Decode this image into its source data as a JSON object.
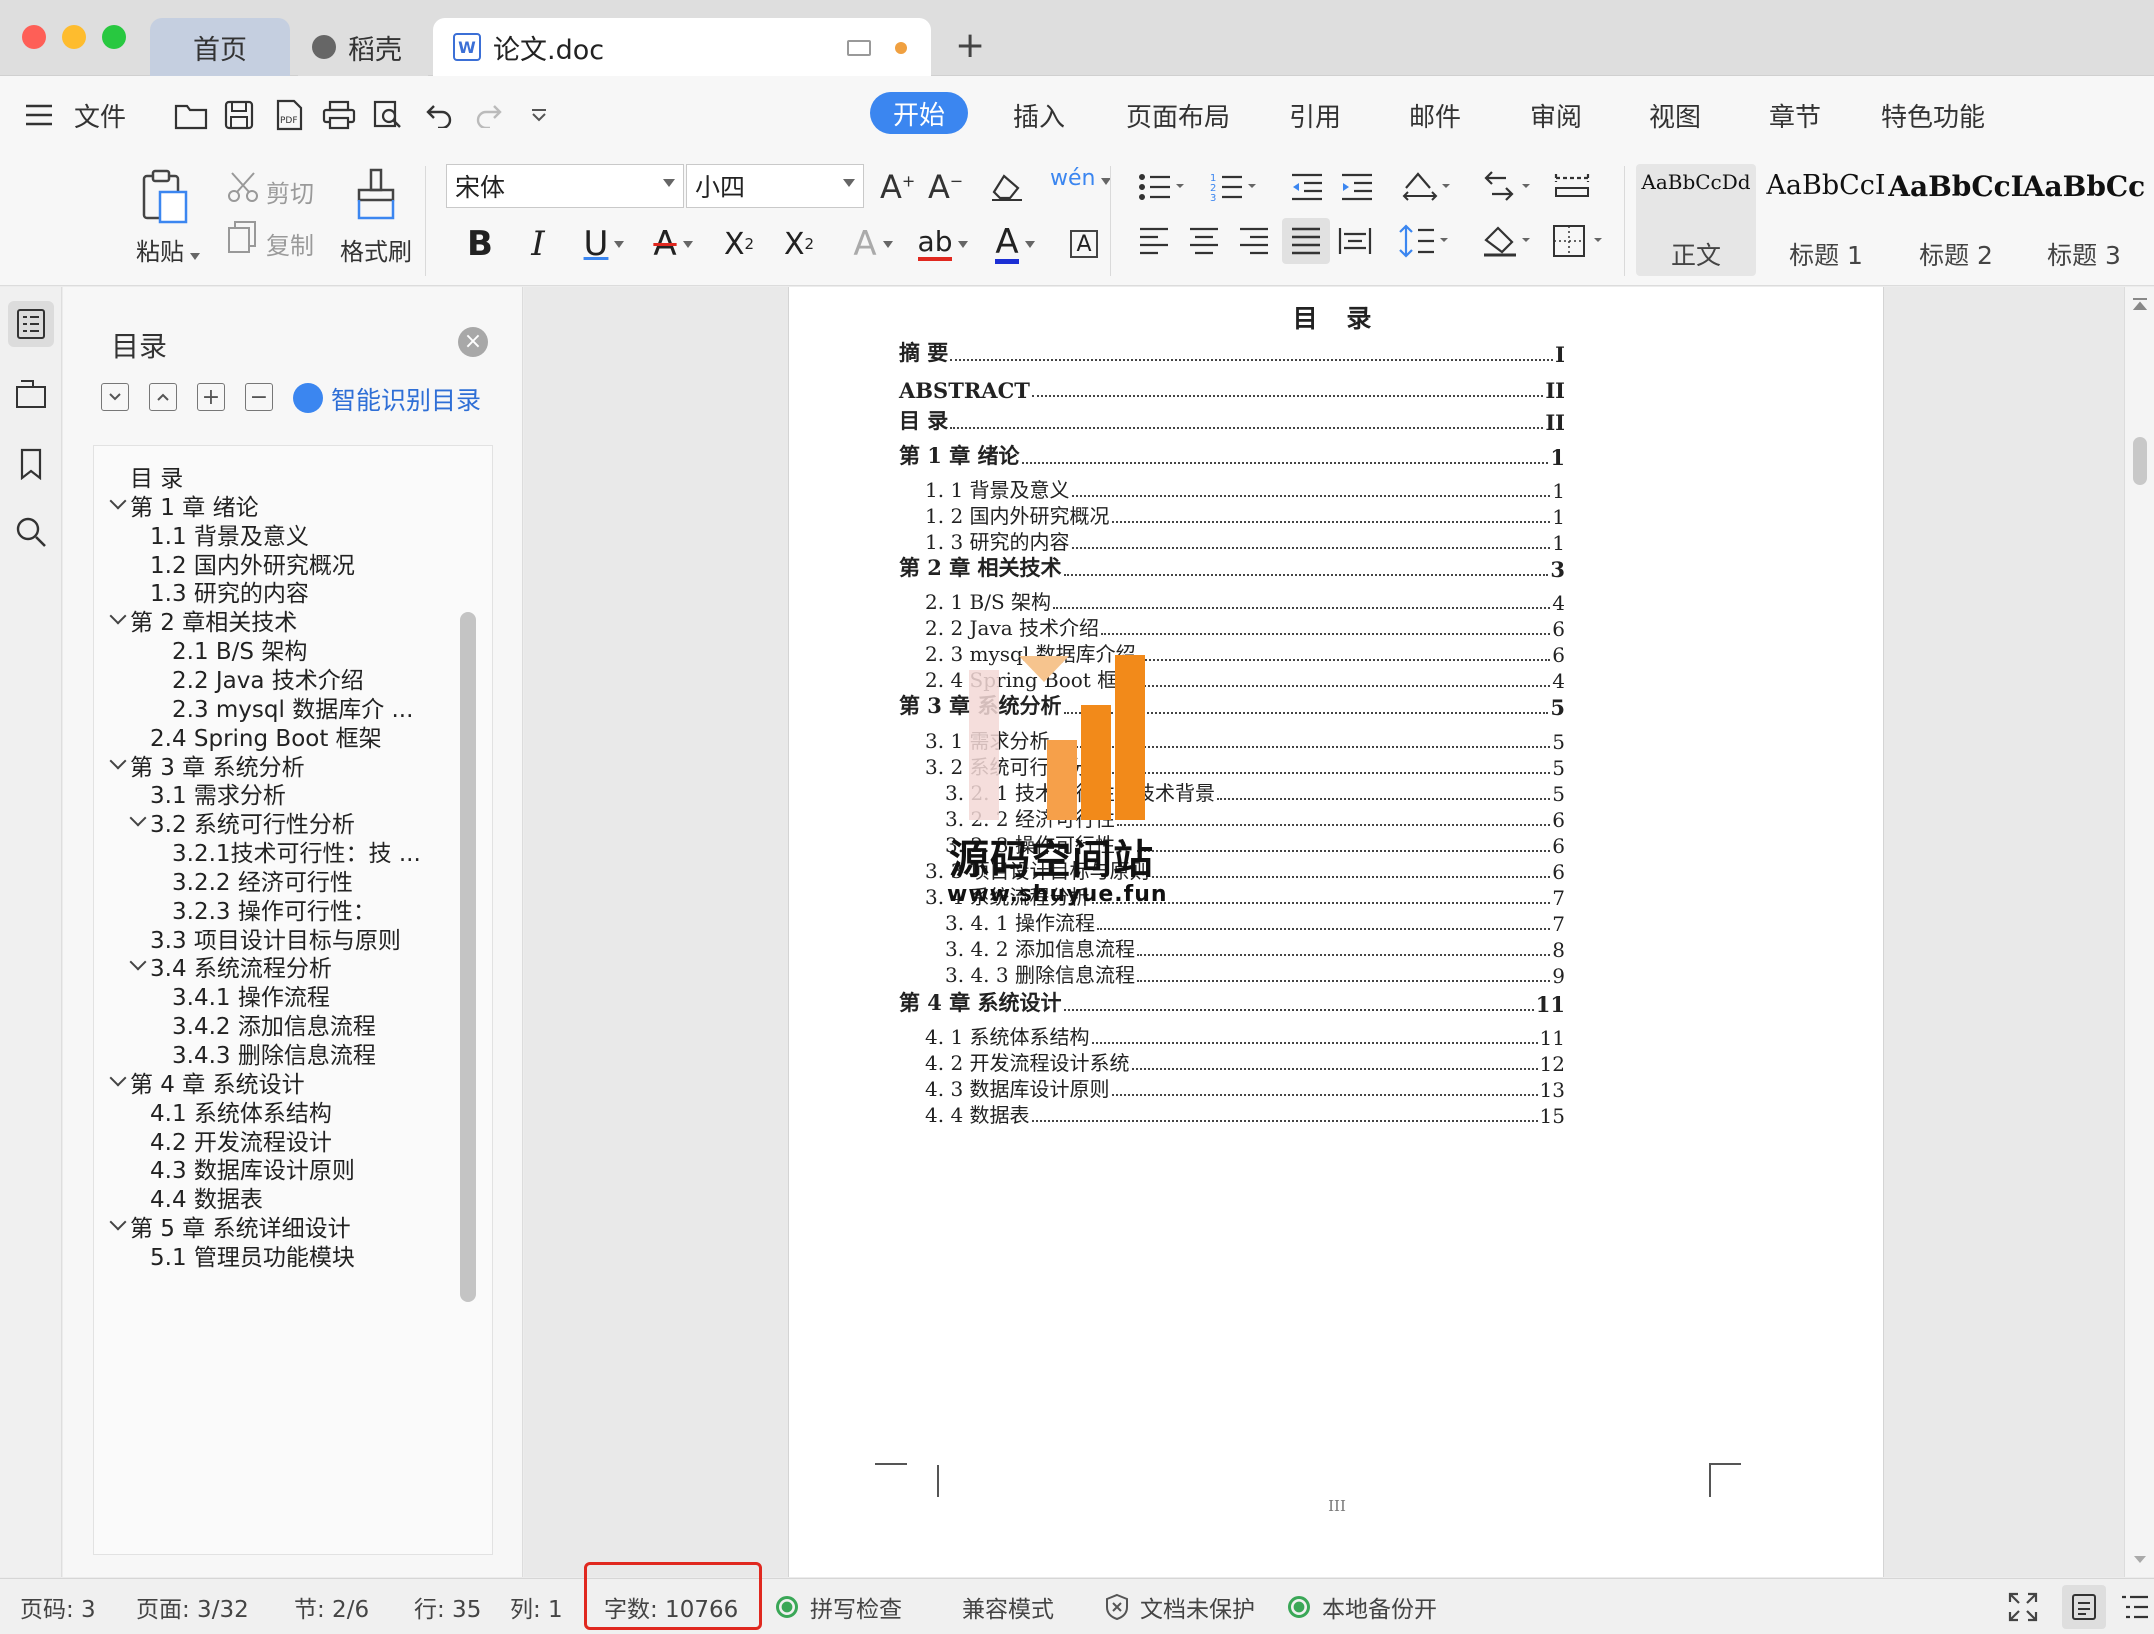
{
  "tabs": [
    {
      "label": "首页"
    },
    {
      "label": "稻壳"
    },
    {
      "label": "论文.doc"
    }
  ],
  "menu": {
    "file": "文件",
    "items": [
      "开始",
      "插入",
      "页面布局",
      "引用",
      "邮件",
      "审阅",
      "视图",
      "章节",
      "特色功能"
    ]
  },
  "ribbon": {
    "paste": "粘贴",
    "cut": "剪切",
    "copy": "复制",
    "format_painter": "格式刷",
    "font": "宋体",
    "size": "小四",
    "styles": [
      {
        "sample": "AaBbCcDd",
        "name": "正文"
      },
      {
        "sample": "AaBbCcI",
        "name": "标题 1"
      },
      {
        "sample": "AaBbCcI",
        "name": "标题 2"
      },
      {
        "sample": "AaBbCc",
        "name": "标题 3"
      }
    ]
  },
  "toc_panel": {
    "title": "目录",
    "smart_label": "智能识别目录",
    "items": [
      {
        "label": "目 录",
        "level": 0,
        "chevron": false
      },
      {
        "label": "第 1 章  绪论",
        "level": 0,
        "chevron": true
      },
      {
        "label": "1.1 背景及意义",
        "level": 1,
        "chevron": false
      },
      {
        "label": "1.2  国内外研究概况",
        "level": 1,
        "chevron": false
      },
      {
        "label": "1.3  研究的内容",
        "level": 1,
        "chevron": false
      },
      {
        "label": "第 2 章相关技术",
        "level": 0,
        "chevron": true
      },
      {
        "label": "2.1    B/S 架构",
        "level": 2,
        "chevron": false
      },
      {
        "label": "2.2    Java 技术介绍",
        "level": 2,
        "chevron": false
      },
      {
        "label": "2.3 mysql 数据库介 ...",
        "level": 2,
        "chevron": false
      },
      {
        "label": "2.4 Spring    Boot 框架",
        "level": 1,
        "chevron": false
      },
      {
        "label": "第 3 章  系统分析",
        "level": 0,
        "chevron": true
      },
      {
        "label": "3.1  需求分析",
        "level": 1,
        "chevron": false
      },
      {
        "label": "3.2   系统可行性分析",
        "level": 1,
        "chevron": true
      },
      {
        "label": "3.2.1技术可行性：技 ...",
        "level": 2,
        "chevron": false
      },
      {
        "label": "3.2.2 经济可行性",
        "level": 2,
        "chevron": false
      },
      {
        "label": "3.2.3 操作可行性：",
        "level": 2,
        "chevron": false
      },
      {
        "label": "3.3  项目设计目标与原则",
        "level": 1,
        "chevron": false
      },
      {
        "label": "3.4 系统流程分析",
        "level": 1,
        "chevron": true
      },
      {
        "label": "3.4.1 操作流程",
        "level": 2,
        "chevron": false
      },
      {
        "label": "3.4.2 添加信息流程",
        "level": 2,
        "chevron": false
      },
      {
        "label": "3.4.3 删除信息流程",
        "level": 2,
        "chevron": false
      },
      {
        "label": "第 4 章  系统设计",
        "level": 0,
        "chevron": true
      },
      {
        "label": "4.1  系统体系结构",
        "level": 1,
        "chevron": false
      },
      {
        "label": "4.2 开发流程设计",
        "level": 1,
        "chevron": false
      },
      {
        "label": "4.3  数据库设计原则",
        "level": 1,
        "chevron": false
      },
      {
        "label": "4.4   数据表",
        "level": 1,
        "chevron": false
      },
      {
        "label": "第 5 章  系统详细设计",
        "level": 0,
        "chevron": true
      },
      {
        "label": "5.1 管理员功能模块",
        "level": 1,
        "chevron": false
      }
    ]
  },
  "document": {
    "title": "目  录",
    "entries": [
      {
        "text": "摘    要",
        "page": "I",
        "bold": true,
        "indent": 0
      },
      {
        "text": "ABSTRACT",
        "page": "II",
        "bold": true,
        "indent": 0
      },
      {
        "text": "目  录",
        "page": "II",
        "bold": true,
        "indent": 0
      },
      {
        "text": "第 1 章  绪论",
        "page": "1",
        "bold": true,
        "indent": 0
      },
      {
        "text": "1. 1 背景及意义",
        "page": "1",
        "bold": false,
        "indent": 1
      },
      {
        "text": "1. 2   国内外研究概况",
        "page": "1",
        "bold": false,
        "indent": 1
      },
      {
        "text": "1. 3   研究的内容",
        "page": "1",
        "bold": false,
        "indent": 1
      },
      {
        "text": "第 2 章  相关技术",
        "page": "3",
        "bold": true,
        "indent": 0
      },
      {
        "text": "2. 1   B/S 架构",
        "page": "4",
        "bold": false,
        "indent": 1
      },
      {
        "text": "2. 2   Java 技术介绍",
        "page": "6",
        "bold": false,
        "indent": 1
      },
      {
        "text": "2. 3   mysql 数据库介绍",
        "page": "6",
        "bold": false,
        "indent": 1
      },
      {
        "text": "2. 4   Spring Boot 框架",
        "page": "4",
        "bold": false,
        "indent": 1
      },
      {
        "text": "第 3 章  系统分析",
        "page": "5",
        "bold": true,
        "indent": 0
      },
      {
        "text": "3. 1   需求分析",
        "page": "5",
        "bold": false,
        "indent": 1
      },
      {
        "text": "3. 2   系统可行性分析",
        "page": "5",
        "bold": false,
        "indent": 1
      },
      {
        "text": "3. 2. 1 技术可行性：技术背景",
        "page": "5",
        "bold": false,
        "indent": 2
      },
      {
        "text": "3. 2. 2 经济可行性",
        "page": "6",
        "bold": false,
        "indent": 2
      },
      {
        "text": "3. 2. 3 操作可行性：",
        "page": "6",
        "bold": false,
        "indent": 2
      },
      {
        "text": "3. 3   项目设计目标与原则",
        "page": "6",
        "bold": false,
        "indent": 1
      },
      {
        "text": "3. 4 系统流程分析",
        "page": "7",
        "bold": false,
        "indent": 1
      },
      {
        "text": "3. 4. 1 操作流程",
        "page": "7",
        "bold": false,
        "indent": 2
      },
      {
        "text": "3. 4. 2 添加信息流程",
        "page": "8",
        "bold": false,
        "indent": 2
      },
      {
        "text": "3. 4. 3 删除信息流程",
        "page": "9",
        "bold": false,
        "indent": 2
      },
      {
        "text": "第 4 章  系统设计",
        "page": "11",
        "bold": true,
        "indent": 0
      },
      {
        "text": "4. 1   系统体系结构",
        "page": "11",
        "bold": false,
        "indent": 1
      },
      {
        "text": "4. 2 开发流程设计系统",
        "page": "12",
        "bold": false,
        "indent": 1
      },
      {
        "text": "4. 3   数据库设计原则",
        "page": "13",
        "bold": false,
        "indent": 1
      },
      {
        "text": "4. 4   数据表",
        "page": "15",
        "bold": false,
        "indent": 1
      }
    ],
    "page_number": "III",
    "watermark": {
      "name": "源码空间站",
      "url": "www.shuyue.fun"
    }
  },
  "status": {
    "page_code": "页码: 3",
    "page": "页面: 3/32",
    "section": "节: 2/6",
    "row": "行: 35",
    "col": "列: 1",
    "word_count": "字数: 10766",
    "spell_check": "拼写检查",
    "compat_mode": "兼容模式",
    "protect": "文档未保护",
    "backup": "本地备份开"
  },
  "colors": {
    "accent": "#3b86f0",
    "highlight": "#e0281f",
    "watermark_orange": "#f28a1a"
  }
}
